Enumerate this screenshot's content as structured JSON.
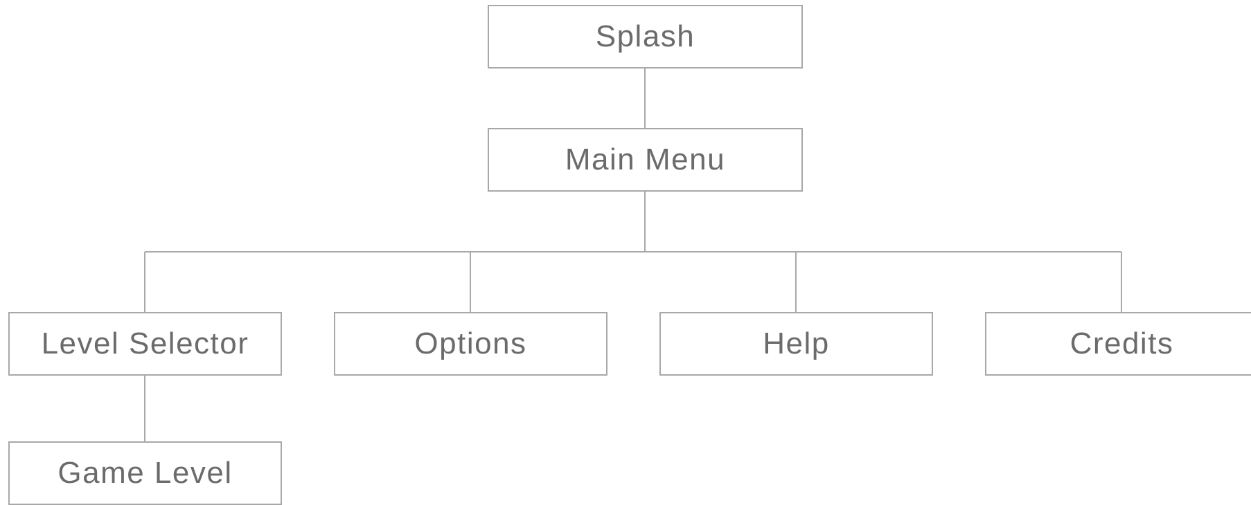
{
  "diagram": {
    "type": "tree",
    "line_color": "#a8a8a8",
    "text_color": "#6b6b6b",
    "nodes": {
      "splash": "Splash",
      "main_menu": "Main Menu",
      "level_selector": "Level Selector",
      "options": "Options",
      "help": "Help",
      "credits": "Credits",
      "game_level": "Game Level"
    },
    "edges": [
      [
        "splash",
        "main_menu"
      ],
      [
        "main_menu",
        "level_selector"
      ],
      [
        "main_menu",
        "options"
      ],
      [
        "main_menu",
        "help"
      ],
      [
        "main_menu",
        "credits"
      ],
      [
        "level_selector",
        "game_level"
      ]
    ]
  }
}
